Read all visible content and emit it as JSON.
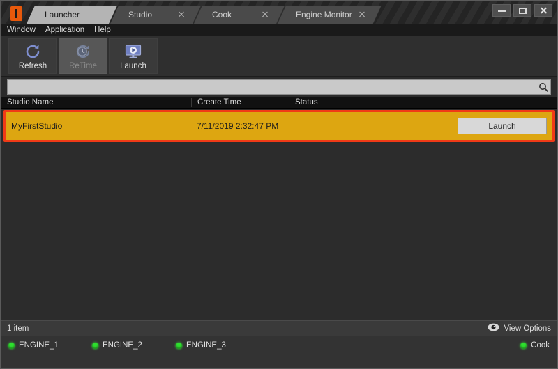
{
  "window": {
    "logo_icon": "app-logo-icon",
    "controls": [
      {
        "name": "minimize-button",
        "glyph": "minimize-icon",
        "label": "Minimize"
      },
      {
        "name": "maximize-button",
        "glyph": "maximize-icon",
        "label": "Maximize"
      },
      {
        "name": "close-button",
        "glyph": "close-icon",
        "label": "Close"
      }
    ]
  },
  "tabs": [
    {
      "label": "Launcher",
      "active": true,
      "closable": false
    },
    {
      "label": "Studio",
      "active": false,
      "closable": true
    },
    {
      "label": "Cook",
      "active": false,
      "closable": true
    },
    {
      "label": "Engine Monitor",
      "active": false,
      "closable": true
    }
  ],
  "menubar": {
    "items": [
      {
        "label": "Window"
      },
      {
        "label": "Application"
      },
      {
        "label": "Help"
      }
    ]
  },
  "toolbar": {
    "buttons": [
      {
        "label": "Refresh",
        "icon": "refresh-icon",
        "disabled": false
      },
      {
        "label": "ReTime",
        "icon": "retime-clock-icon",
        "disabled": true
      },
      {
        "label": "Launch",
        "icon": "launch-monitor-icon",
        "disabled": false
      }
    ]
  },
  "search": {
    "value": "",
    "placeholder": "",
    "icon": "search-icon"
  },
  "table": {
    "columns": [
      "Studio Name",
      "Create Time",
      "Status"
    ],
    "rows": [
      {
        "studio_name": "MyFirstStudio",
        "create_time": "7/11/2019 2:32:47 PM",
        "status": "",
        "action_label": "Launch",
        "selected": true
      }
    ]
  },
  "statusbar": {
    "item_count": "1 item",
    "view_options_label": "View Options",
    "view_options_icon": "eye-icon"
  },
  "engines": [
    {
      "label": "ENGINE_1",
      "state": "online"
    },
    {
      "label": "ENGINE_2",
      "state": "online"
    },
    {
      "label": "ENGINE_3",
      "state": "online"
    }
  ],
  "engine_right": {
    "label": "Cook",
    "state": "online"
  },
  "colors": {
    "selection": "#dda611",
    "annotation": "#f03a17",
    "led_online": "#2ee02e",
    "accent_logo": "#e8590c"
  }
}
